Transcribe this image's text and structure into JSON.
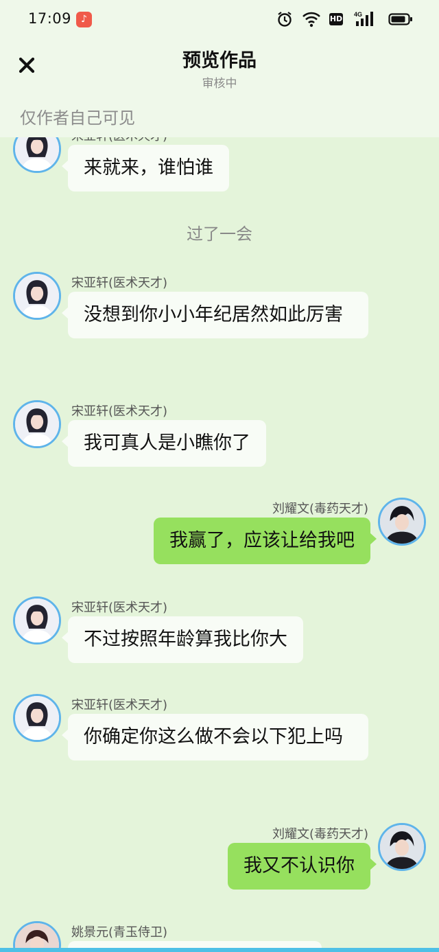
{
  "status_bar": {
    "time": "17:09",
    "hd_label": "HD",
    "network_label": "4G",
    "music_icon": "music-note-icon",
    "icons": [
      "alarm-icon",
      "wifi-icon",
      "hd-icon",
      "signal-icon",
      "battery-icon"
    ]
  },
  "header": {
    "title": "预览作品",
    "subtitle": "审核中",
    "close_icon": "close-icon",
    "visibility_note": "仅作者自己可见"
  },
  "chat": {
    "divider_text": "过了一会",
    "messages": [
      {
        "side": "left",
        "sender": "宋亚轩(医术天才)",
        "text": "来就来，谁怕谁",
        "avatar": "avatar-song"
      },
      {
        "side": "left",
        "sender": "宋亚轩(医术天才)",
        "text": "没想到你小小年纪居然如此厉害",
        "avatar": "avatar-song"
      },
      {
        "side": "left",
        "sender": "宋亚轩(医术天才)",
        "text": "我可真人是小瞧你了",
        "avatar": "avatar-song"
      },
      {
        "side": "right",
        "sender": "刘耀文(毒药天才)",
        "text": "我赢了，应该让给我吧",
        "avatar": "avatar-liu"
      },
      {
        "side": "left",
        "sender": "宋亚轩(医术天才)",
        "text": "不过按照年龄算我比你大",
        "avatar": "avatar-song"
      },
      {
        "side": "left",
        "sender": "宋亚轩(医术天才)",
        "text": "你确定你这么做不会以下犯上吗",
        "avatar": "avatar-song"
      },
      {
        "side": "right",
        "sender": "刘耀文(毒药天才)",
        "text": "我又不认识你",
        "avatar": "avatar-liu"
      },
      {
        "side": "left",
        "sender": "姚景元(青玉侍卫)",
        "text": "",
        "avatar": "avatar-yao"
      }
    ]
  },
  "colors": {
    "background": "#e4f4da",
    "left_bubble": "#f8fcf6",
    "right_bubble": "#96e05e",
    "avatar_border": "#5fb4ea"
  }
}
